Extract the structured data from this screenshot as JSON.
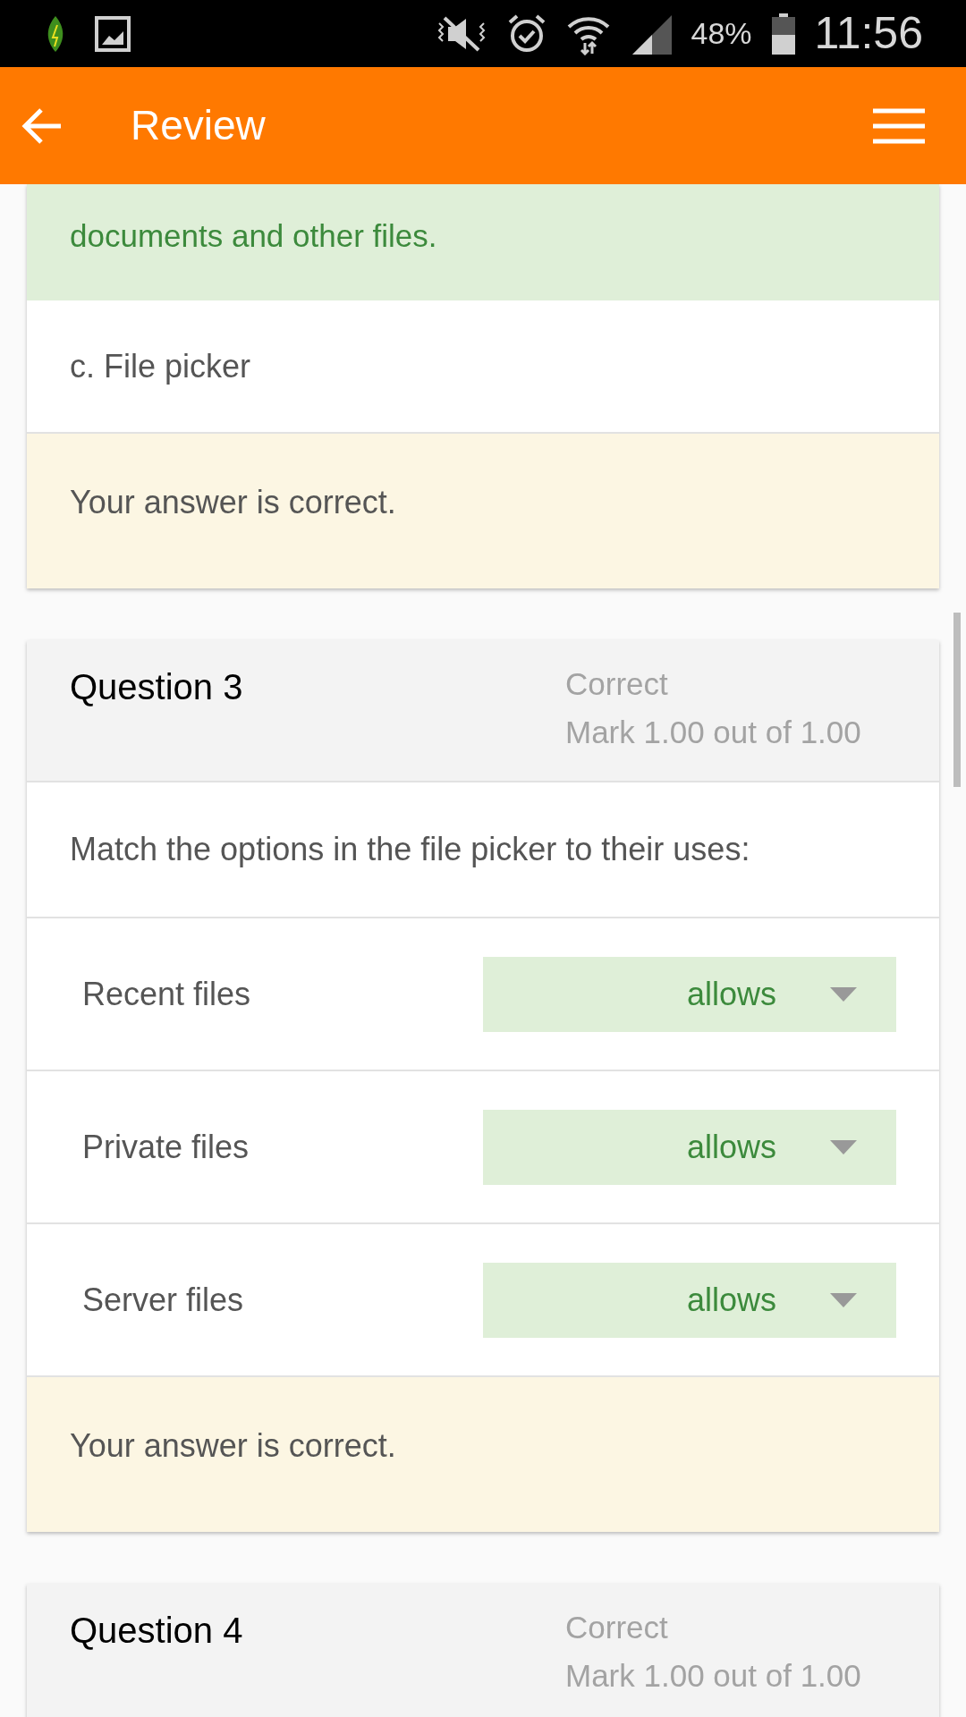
{
  "status_bar": {
    "battery": "48%",
    "time": "11:56"
  },
  "app_bar": {
    "title": "Review"
  },
  "previous_question": {
    "feedback_text": "documents and other files.",
    "answer": "c. File picker",
    "result": "Your answer is correct."
  },
  "questions": [
    {
      "title": "Question 3",
      "status": "Correct",
      "mark": "Mark 1.00 out of 1.00",
      "prompt": "Match the options in the file picker to their uses:",
      "matches": [
        {
          "label": "Recent files",
          "value": "allows",
          "correct": true
        },
        {
          "label": "Private files",
          "value": "allows",
          "correct": true
        },
        {
          "label": "Server files",
          "value": "allows",
          "correct": true
        }
      ],
      "result": "Your answer is correct."
    },
    {
      "title": "Question 4",
      "status": "Correct",
      "mark": "Mark 1.00 out of 1.00"
    }
  ]
}
